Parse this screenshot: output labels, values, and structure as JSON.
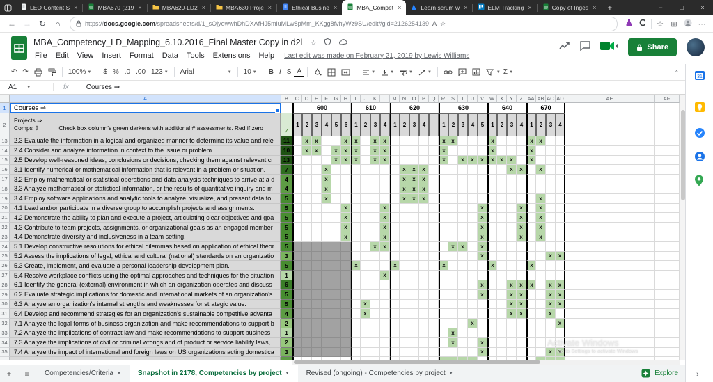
{
  "browser": {
    "nav_back": "←",
    "nav_forward": "→",
    "nav_refresh": "↻",
    "nav_home": "⌂",
    "read_aloud": "A",
    "fav_star": "☆",
    "collections": "⊞",
    "more": "⋯",
    "min": "−",
    "max": "□",
    "close": "×",
    "new_tab": "+",
    "tab_close": "×",
    "url_prefix": "https://",
    "url_bold": "docs.google.com",
    "url_rest": "/spreadsheets/d/1_sOjyowwhDhDXAfHJ5miuMLw8pMm_KKgg8fvhyWz9SU/edit#gid=2126254139",
    "tabs": [
      {
        "label": "LEO Content S",
        "icon": "doc",
        "active": false
      },
      {
        "label": "MBA670 (219",
        "icon": "sheets",
        "active": false
      },
      {
        "label": "MBA620-LD2",
        "icon": "folder",
        "active": false
      },
      {
        "label": "MBA630 Proje",
        "icon": "folder",
        "active": false
      },
      {
        "label": "Ethical Busine",
        "icon": "docs-blue",
        "active": false
      },
      {
        "label": "MBA_Compet",
        "icon": "sheets",
        "active": true
      },
      {
        "label": "Learn scrum w",
        "icon": "atlassian",
        "active": false
      },
      {
        "label": "ELM Tracking",
        "icon": "trello",
        "active": false
      },
      {
        "label": "Copy of Inges",
        "icon": "sheets",
        "active": false
      }
    ]
  },
  "header": {
    "title": "MBA_Competency_LD_Mapping_6.10.2016_Final Master Copy in d2l",
    "star": "☆",
    "menu": [
      "File",
      "Edit",
      "View",
      "Insert",
      "Format",
      "Data",
      "Tools",
      "Extensions",
      "Help"
    ],
    "last_edit": "Last edit was made on February 21, 2019 by Lewis Williams",
    "share_label": "Share"
  },
  "toolbar": {
    "undo": "↶",
    "redo": "↷",
    "zoom": "100%",
    "currency": "$",
    "percent": "%",
    "dec_dec": ".0",
    "dec_inc": ".00",
    "more_formats": "123",
    "font": "Arial",
    "font_size": "10",
    "bold": "B",
    "italic": "I",
    "strike": "S",
    "text_color": "A",
    "functions": "Σ",
    "collapse": "^"
  },
  "formula_bar": {
    "name_box": "A1",
    "fx_label": "fx",
    "value": "Courses ⇒"
  },
  "grid": {
    "corner_a1": "Courses ⇒",
    "note_line1": "Projects ⇒",
    "note_line2a": "Comps ⇩",
    "note_line2b": "Check box column's green darkens with additional # assessments. Red if zero",
    "check_mark": "✓",
    "row1_num": "1",
    "row2_num": "2",
    "col_a_letter": "A",
    "col_letters": [
      "B",
      "C",
      "D",
      "E",
      "F",
      "G",
      "H",
      "I",
      "J",
      "K",
      "L",
      "M",
      "N",
      "O",
      "P",
      "Q",
      "R",
      "S",
      "T",
      "U",
      "V",
      "W",
      "X",
      "Y",
      "Z",
      "AA",
      "AB",
      "AC",
      "AD",
      "AE",
      "AF"
    ],
    "data_cols": [
      "C",
      "D",
      "E",
      "F",
      "G",
      "H",
      "I",
      "J",
      "K",
      "L",
      "M",
      "N",
      "O",
      "P",
      "Q",
      "R",
      "S",
      "T",
      "U",
      "V",
      "W",
      "X",
      "Y",
      "Z",
      "AA",
      "AB",
      "AC",
      "AD"
    ],
    "groups": [
      {
        "label": "600",
        "cols": [
          "C",
          "D",
          "E",
          "F",
          "G",
          "H"
        ],
        "nums": [
          "1",
          "2",
          "3",
          "4",
          "5",
          "6"
        ]
      },
      {
        "label": "610",
        "cols": [
          "I",
          "J",
          "K",
          "L"
        ],
        "nums": [
          "1",
          "2",
          "3",
          "4"
        ]
      },
      {
        "label": "620",
        "cols": [
          "M",
          "N",
          "O",
          "P",
          "Q"
        ],
        "nums": [
          "1",
          "2",
          "3",
          "4",
          ""
        ]
      },
      {
        "label": "630",
        "cols": [
          "R",
          "S",
          "T",
          "U",
          "V"
        ],
        "nums": [
          "1",
          "2",
          "3",
          "4",
          "5"
        ]
      },
      {
        "label": "640",
        "cols": [
          "W",
          "X",
          "Y",
          "Z"
        ],
        "nums": [
          "1",
          "2",
          "3",
          "4"
        ]
      },
      {
        "label": "670",
        "cols": [
          "AA",
          "AB",
          "AC",
          "AD"
        ],
        "nums": [
          "1",
          "2",
          "3",
          "4"
        ]
      }
    ],
    "rows": [
      {
        "n": 13,
        "count": 11,
        "label": "2.3 Evaluate  the information in a logical and organized manner to determine its value and rele",
        "x": [
          "D",
          "E",
          "H",
          "I",
          "K",
          "L",
          "R",
          "S",
          "W",
          "AA",
          "AB"
        ]
      },
      {
        "n": 14,
        "count": 10,
        "label": "2.4 Consider and analyze information in context to the issue or problem.",
        "x": [
          "D",
          "E",
          "G",
          "H",
          "I",
          "K",
          "L",
          "R",
          "W",
          "AA"
        ]
      },
      {
        "n": 15,
        "count": 13,
        "label": "2.5 Develop well-reasoned ideas, conclusions or decisions, checking them against relevant cr",
        "x": [
          "G",
          "H",
          "I",
          "K",
          "L",
          "R",
          "T",
          "U",
          "V",
          "W",
          "X",
          "Y",
          "AA"
        ]
      },
      {
        "n": 16,
        "count": 7,
        "label": "3.1 Identify numerical or mathematical information that is relevant in a problem or situation.",
        "x": [
          "F",
          "N",
          "O",
          "P",
          "Y",
          "Z",
          "AB"
        ]
      },
      {
        "n": 17,
        "count": 4,
        "label": "3.2 Employ mathematical or statistical operations and data analysis techniques to arrive at a d",
        "x": [
          "F",
          "N",
          "O",
          "P"
        ]
      },
      {
        "n": 18,
        "count": 4,
        "label": "3.3 Analyze mathematical or statistical information, or the results of quantitative inquiry and m",
        "x": [
          "F",
          "N",
          "O",
          "P"
        ]
      },
      {
        "n": 19,
        "count": 5,
        "label": "3.4 Employ software applications and analytic tools to analyze, visualize, and present data to",
        "x": [
          "F",
          "N",
          "O",
          "P",
          "AB"
        ]
      },
      {
        "n": 20,
        "count": 5,
        "label": "4.1 Lead and/or participate in a diverse group to accomplish projects and assignments.",
        "x": [
          "H",
          "L",
          "V",
          "Z",
          "AB"
        ]
      },
      {
        "n": 21,
        "count": 5,
        "label": "4.2 Demonstrate the ability to plan and execute a project, articulating clear objectives and goa",
        "x": [
          "H",
          "L",
          "V",
          "Z",
          "AB"
        ]
      },
      {
        "n": 22,
        "count": 5,
        "label": "4.3 Contribute to team projects, assignments, or organizational goals as an engaged member",
        "x": [
          "H",
          "L",
          "V",
          "Z",
          "AB"
        ]
      },
      {
        "n": 23,
        "count": 5,
        "label": "4.4 Demonstrate diversity and inclusiveness in a team setting.",
        "x": [
          "H",
          "L",
          "V",
          "Z",
          "AB"
        ]
      },
      {
        "n": 24,
        "count": 5,
        "label": "5.1 Develop constructive resolutions for ethical dilemmas based on application of ethical theor",
        "x": [
          "K",
          "L",
          "S",
          "T",
          "V"
        ]
      },
      {
        "n": 25,
        "count": 3,
        "label": "5.2 Assess the implications of legal, ethical and cultural (national) standards on an organizatio",
        "x": [
          "V",
          "AC",
          "AD"
        ]
      },
      {
        "n": 26,
        "count": 5,
        "label": "5.3 Create, implement, and evaluate a personal  leadership development plan.",
        "x": [
          "I",
          "M",
          "R",
          "W",
          "AA"
        ]
      },
      {
        "n": 27,
        "count": 1,
        "label": "5.4 Resolve workplace conflicts using the optimal approaches and techniques for the situation",
        "x": [
          "L"
        ]
      },
      {
        "n": 28,
        "count": 6,
        "label": "6.1 Identify the general (external) environment in which an organization operates and discuss",
        "x": [
          "V",
          "Y",
          "Z",
          "AA",
          "AC",
          "AD"
        ]
      },
      {
        "n": 29,
        "count": 5,
        "label": "6.2 Evaluate strategic implications for domestic and international markets of an organization's",
        "x": [
          "V",
          "Y",
          "Z",
          "AC",
          "AD"
        ]
      },
      {
        "n": 30,
        "count": 5,
        "label": "6.3 Analyze an organization's internal strengths and weaknesses for strategic value.",
        "x": [
          "J",
          "Y",
          "Z",
          "AC",
          "AD"
        ]
      },
      {
        "n": 31,
        "count": 4,
        "label": "6.4 Develop and recommend strategies for an organization's sustainable competitive advanta",
        "x": [
          "J",
          "Y",
          "Z",
          "AC"
        ]
      },
      {
        "n": 32,
        "count": 2,
        "label": "7.1 Analyze the legal forms of business organization and make recommendations to support b",
        "x": [
          "U",
          "AD"
        ]
      },
      {
        "n": 33,
        "count": 1,
        "label": "7.2 Analyze the implications of contract law and make recommendations to support business",
        "x": [
          "S"
        ]
      },
      {
        "n": 34,
        "count": 2,
        "label": "7.3 Analyze the implications of civil or criminal wrongs and of product or service liability laws,",
        "x": [
          "S",
          "V"
        ]
      },
      {
        "n": 35,
        "count": 3,
        "label": "7.4 Analyze the impact of international and foreign laws on US organizations acting domestica",
        "x": [
          "V",
          "AC",
          "AD"
        ]
      }
    ],
    "gray_rows_from": 24,
    "gray_cols": [
      "C",
      "D",
      "E",
      "F",
      "G",
      "H"
    ],
    "sliver_x": [
      "R",
      "S",
      "T",
      "U",
      "AB",
      "AC",
      "AD"
    ]
  },
  "footer": {
    "sheet_tabs": [
      {
        "label": "Competencies/Criteria",
        "active": false
      },
      {
        "label": "Snapshot in 2178, Competencies by project",
        "active": true
      },
      {
        "label": "Revised (ongoing) - Competencies by project",
        "active": false
      }
    ],
    "explore_label": "Explore",
    "add_sheet": "+",
    "all_sheets": "≡",
    "panel_chevron": "›"
  },
  "watermark": {
    "line1": "Activate Windows",
    "line2": "Go to Settings to activate Windows"
  },
  "colors": {
    "accent_green": "#188038",
    "x_cell": "#b7d7a9",
    "selection_blue": "#1a73e8",
    "count_scale": {
      "1": "#b6d7a8",
      "2": "#97c77d",
      "3": "#79b35d",
      "4": "#5d9c44",
      "5": "#478c30",
      "6": "#3a7d28",
      "7": "#2f6e20",
      "10": "#1e5212"
    }
  }
}
